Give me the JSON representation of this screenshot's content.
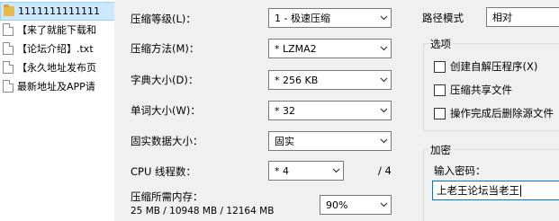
{
  "file_list": [
    {
      "name": "1111111111111",
      "type": "folder",
      "selected": true
    },
    {
      "name": "【来了就能下载和",
      "type": "doc"
    },
    {
      "name": "【论坛介绍】.txt",
      "type": "doc"
    },
    {
      "name": "【永久地址发布页",
      "type": "doc"
    },
    {
      "name": "最新地址及APP请",
      "type": "doc"
    }
  ],
  "labels": {
    "compression_level": "压缩等级(L)：",
    "compression_method": "压缩方法(M)：",
    "dictionary_size": "字典大小(D)：",
    "word_size": "单词大小(W)：",
    "solid_block_size": "固实数据大小：",
    "cpu_threads": "CPU 线程数：",
    "memory_usage": "压缩所需内存：",
    "memory_values": "25 MB / 10948 MB / 12164 MB",
    "thread_total": "/ 4",
    "path_mode": "路径模式",
    "options": "选项",
    "encryption": "加密",
    "enter_password": "输入密码："
  },
  "values": {
    "compression_level": "1 - 极速压缩",
    "compression_method": "* LZMA2",
    "dictionary_size": "* 256 KB",
    "word_size": "* 32",
    "solid_block_size": "固实",
    "cpu_threads": "* 4",
    "memory_percent": "90%",
    "path_mode": "相对",
    "password": "上老王论坛当老王"
  },
  "options": [
    {
      "label": "创建自解压程序(X)",
      "checked": false
    },
    {
      "label": "压缩共享文件",
      "checked": false
    },
    {
      "label": "操作完成后删除源文件",
      "checked": false
    }
  ]
}
